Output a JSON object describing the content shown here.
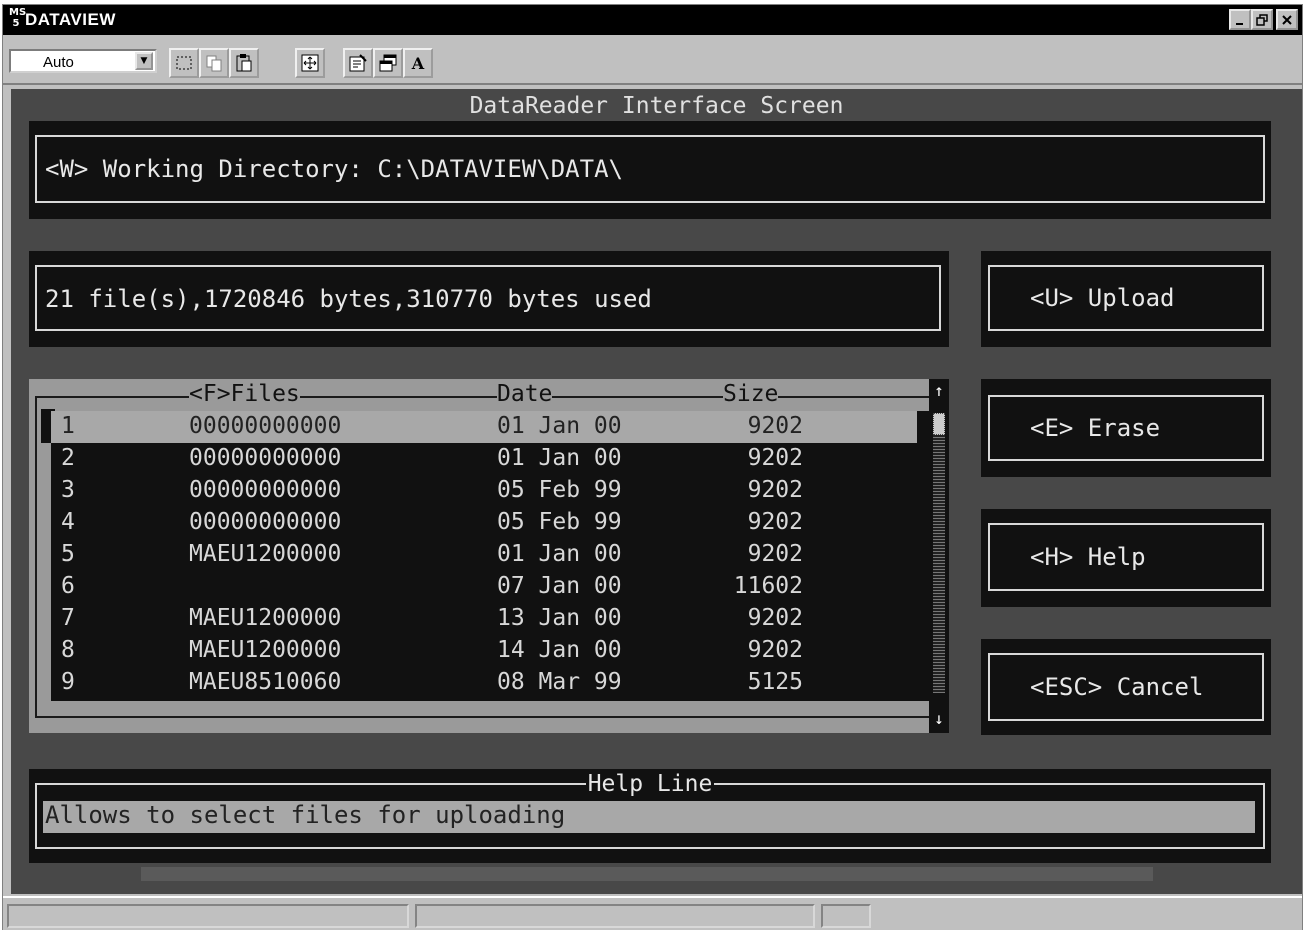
{
  "window": {
    "title": "DATAVIEW",
    "logo": "MS-DOS",
    "controls": [
      "minimize",
      "restore",
      "close"
    ],
    "colors": {
      "titlebar": "#000000",
      "chrome": "#c0c0c0",
      "console_bg": "#484848",
      "panel": "#111111"
    }
  },
  "toolbar": {
    "font_combo_value": "Auto",
    "buttons": [
      "mark-icon",
      "copy-icon",
      "paste-icon",
      "fullscreen-icon",
      "properties-icon",
      "background-icon",
      "font-icon"
    ],
    "font_button_label": "A"
  },
  "screen": {
    "title": "DataReader Interface Screen",
    "working_directory": "<W> Working Directory: C:\\DATAVIEW\\DATA\\",
    "status": "21 file(s),1720846 bytes,310770 bytes used"
  },
  "actions": {
    "upload": "<U> Upload",
    "erase": "<E> Erase",
    "help": "<H> Help",
    "cancel": "<ESC> Cancel"
  },
  "file_list": {
    "headers": {
      "files": "<F>Files",
      "date": "Date",
      "size": "Size"
    },
    "selected_index": 0,
    "rows": [
      {
        "num": "1",
        "file": "00000000000",
        "date": "01 Jan 00",
        "size": "9202"
      },
      {
        "num": "2",
        "file": "00000000000",
        "date": "01 Jan 00",
        "size": "9202"
      },
      {
        "num": "3",
        "file": "00000000000",
        "date": "05 Feb 99",
        "size": "9202"
      },
      {
        "num": "4",
        "file": "00000000000",
        "date": "05 Feb 99",
        "size": "9202"
      },
      {
        "num": "5",
        "file": "MAEU1200000",
        "date": "01 Jan 00",
        "size": "9202"
      },
      {
        "num": "6",
        "file": "",
        "date": "07 Jan 00",
        "size": "11602"
      },
      {
        "num": "7",
        "file": "MAEU1200000",
        "date": "13 Jan 00",
        "size": "9202"
      },
      {
        "num": "8",
        "file": "MAEU1200000",
        "date": "14 Jan 00",
        "size": "9202"
      },
      {
        "num": "9",
        "file": "MAEU8510060",
        "date": "08 Mar 99",
        "size": "5125"
      }
    ],
    "scroll_up": "↑",
    "scroll_down": "↓"
  },
  "help_line": {
    "label": "Help Line",
    "text": "Allows to select files for uploading"
  }
}
